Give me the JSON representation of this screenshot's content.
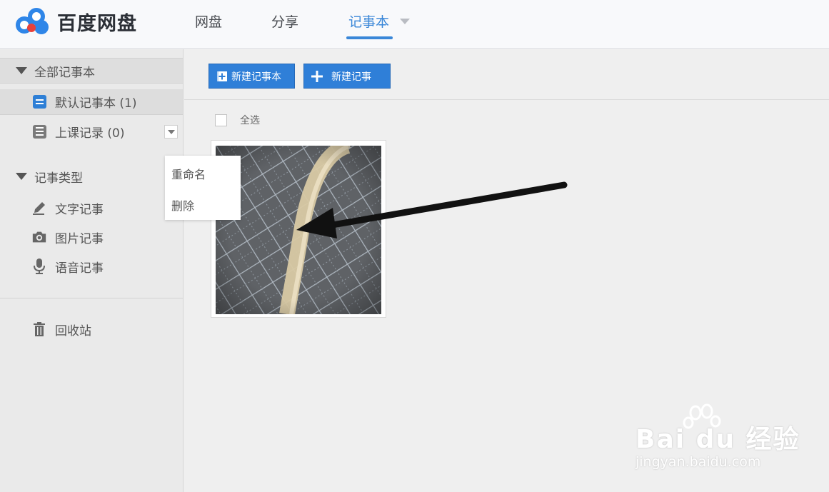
{
  "header": {
    "logo_text": "百度网盘",
    "nav": [
      {
        "label": "网盘"
      },
      {
        "label": "分享"
      },
      {
        "label": "记事本",
        "active": true
      }
    ]
  },
  "sidebar": {
    "all_notebooks_label": "全部记事本",
    "notebooks": [
      {
        "label": "默认记事本 (1)",
        "color": "#2e7fd6"
      },
      {
        "label": "上课记录 (0)",
        "color": "#7a7a7a"
      }
    ],
    "types_label": "记事类型",
    "types": [
      {
        "label": "文字记事",
        "icon": "pencil-icon"
      },
      {
        "label": "图片记事",
        "icon": "camera-icon"
      },
      {
        "label": "语音记事",
        "icon": "microphone-icon"
      }
    ],
    "trash_label": "回收站"
  },
  "context_menu": {
    "items": [
      {
        "label": "重命名"
      },
      {
        "label": "删除"
      }
    ]
  },
  "toolbar": {
    "new_notebook_label": "新建记事本",
    "new_note_label": "新建记事"
  },
  "list": {
    "select_all_label": "全选"
  },
  "watermark": {
    "brand": "Bai du 经验",
    "url": "jingyan.baidu.com"
  },
  "colors": {
    "accent": "#3a87d8",
    "button": "#2f7fd8"
  }
}
